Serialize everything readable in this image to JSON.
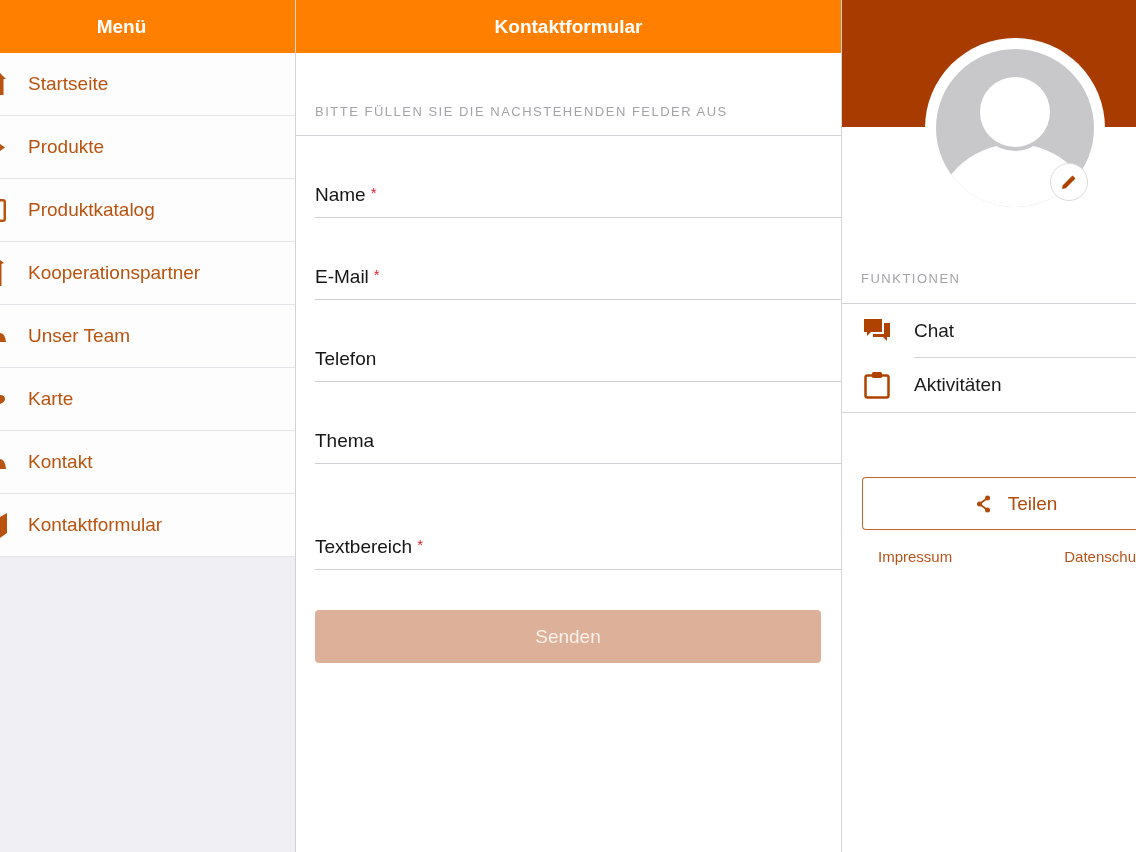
{
  "menu": {
    "title": "Menü",
    "items": [
      {
        "label": "Startseite"
      },
      {
        "label": "Produkte"
      },
      {
        "label": "Produktkatalog"
      },
      {
        "label": "Kooperationspartner"
      },
      {
        "label": "Unser Team"
      },
      {
        "label": "Karte"
      },
      {
        "label": "Kontakt"
      },
      {
        "label": "Kontaktformular"
      }
    ]
  },
  "contact_form": {
    "title": "Kontaktformular",
    "instruction": "BITTE FÜLLEN SIE DIE NACHSTEHENDEN FELDER AUS",
    "fields": [
      {
        "label": "Name",
        "required_mark": "*",
        "kind": "input"
      },
      {
        "label": "E-Mail",
        "required_mark": "*",
        "kind": "input"
      },
      {
        "label": "Telefon",
        "kind": "input"
      },
      {
        "label": "Thema",
        "kind": "input"
      },
      {
        "label": "Textbereich",
        "required_mark": "*",
        "kind": "textarea"
      }
    ],
    "submit_button": {
      "label": "Senden",
      "disabled": true
    }
  },
  "profile": {
    "section_title": "FUNKTIONEN",
    "functions": [
      {
        "label": "Chat"
      },
      {
        "label": "Aktivitäten"
      }
    ],
    "share_button": {
      "label": "Teilen"
    },
    "links": [
      {
        "label": "Impressum"
      },
      {
        "label": "Datenschu"
      }
    ]
  }
}
